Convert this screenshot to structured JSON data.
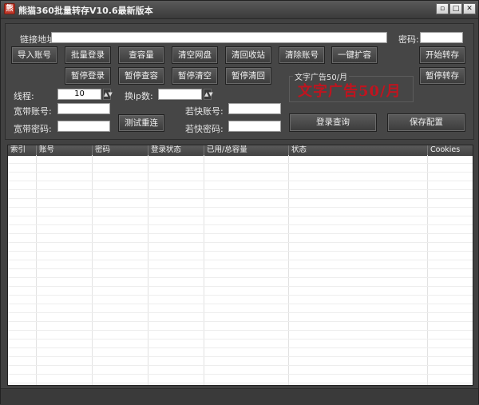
{
  "window": {
    "title": "熊猫360批量转存V10.6最新版本",
    "controls": {
      "minimize": "▫",
      "maximize": "□",
      "close": "✕"
    }
  },
  "form": {
    "link_label": "链接地址:",
    "link_value": "",
    "password_label": "密码:",
    "password_value": "",
    "threads_label": "线程:",
    "threads_value": "10",
    "ip_change_label": "换ip数:",
    "ip_change_value": "",
    "broadband_account_label": "宽带账号:",
    "broadband_account_value": "",
    "broadband_password_label": "宽带密码:",
    "broadband_password_value": "",
    "ruokuai_account_label": "若快账号:",
    "ruokuai_account_value": "",
    "ruokuai_password_label": "若快密码:",
    "ruokuai_password_value": ""
  },
  "buttons": {
    "import_accounts": "导入账号",
    "batch_login": "批量登录",
    "check_capacity": "查容量",
    "clear_disk": "清空网盘",
    "clear_recycle": "清回收站",
    "clear_accounts": "清除账号",
    "one_click_expand": "一键扩容",
    "start_transfer": "开始转存",
    "pause_login": "暂停登录",
    "pause_check": "暂停查容",
    "pause_clear": "暂停清空",
    "pause_recycle": "暂停清回",
    "pause_transfer": "暂停转存",
    "test_reconnect": "测试重连",
    "login_query": "登录查询",
    "save_config": "保存配置"
  },
  "ad": {
    "caption": "文字广告50/月",
    "text": "文字广告50/月",
    "color": "#c0141f"
  },
  "table": {
    "columns": [
      "索引",
      "账号",
      "密码",
      "登录状态",
      "已用/总容量",
      "状态",
      "Cookies"
    ],
    "rows": []
  },
  "icons": {
    "app": "panda-logo-icon",
    "spin_up": "▲",
    "spin_down": "▼"
  }
}
